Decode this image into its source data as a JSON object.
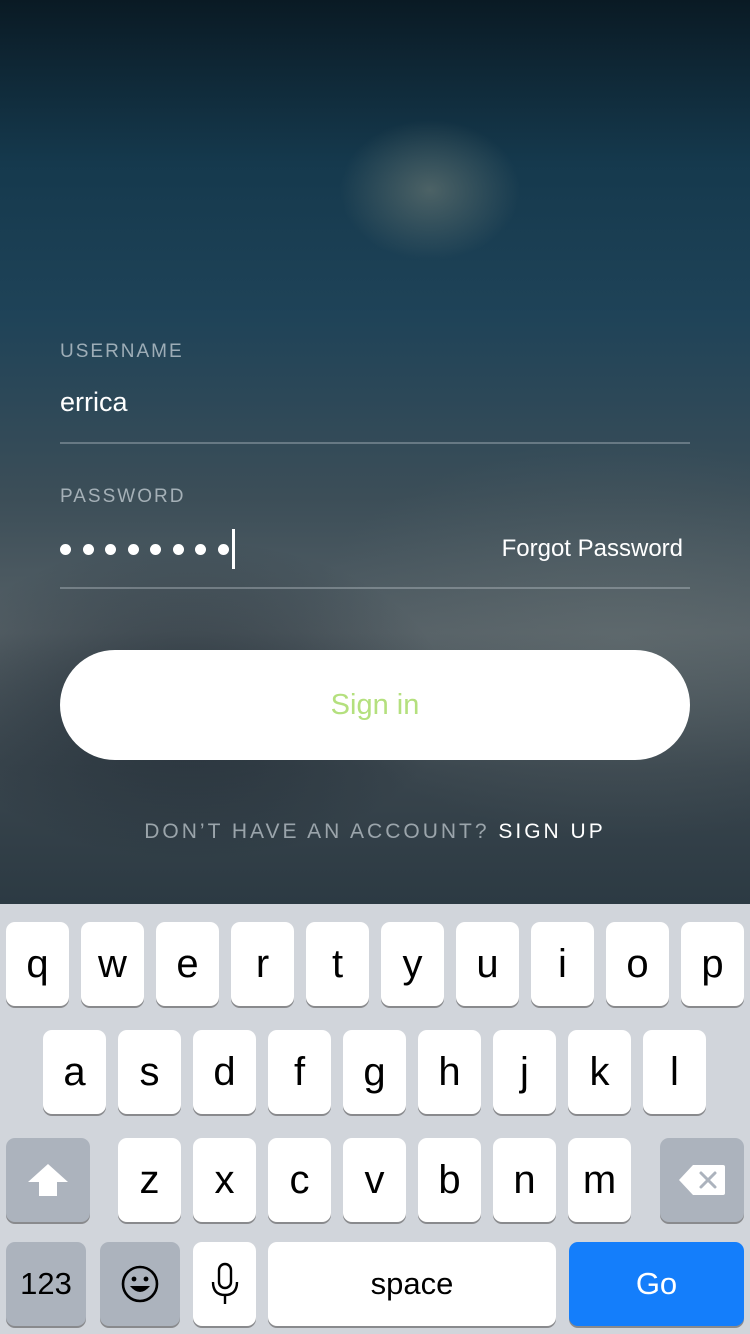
{
  "form": {
    "username_label": "USERNAME",
    "username_value": "errica",
    "password_label": "PASSWORD",
    "password_dots": 8,
    "forgot_password": "Forgot Password",
    "signin_label": "Sign in",
    "signup_question": "DON’T HAVE AN ACCOUNT?",
    "signup_link": "SIGN UP"
  },
  "colors": {
    "signin_text": "#b4e07e",
    "go_key": "#147efb",
    "keyboard_bg": "#d1d5db"
  },
  "keyboard": {
    "row1": [
      "q",
      "w",
      "e",
      "r",
      "t",
      "y",
      "u",
      "i",
      "o",
      "p"
    ],
    "row2": [
      "a",
      "s",
      "d",
      "f",
      "g",
      "h",
      "j",
      "k",
      "l"
    ],
    "row3": [
      "z",
      "x",
      "c",
      "v",
      "b",
      "n",
      "m"
    ],
    "shift_icon": "shift-icon",
    "delete_icon": "delete-icon",
    "numbers_label": "123",
    "emoji_icon": "emoji-icon",
    "mic_icon": "microphone-icon",
    "space_label": "space",
    "go_label": "Go"
  }
}
